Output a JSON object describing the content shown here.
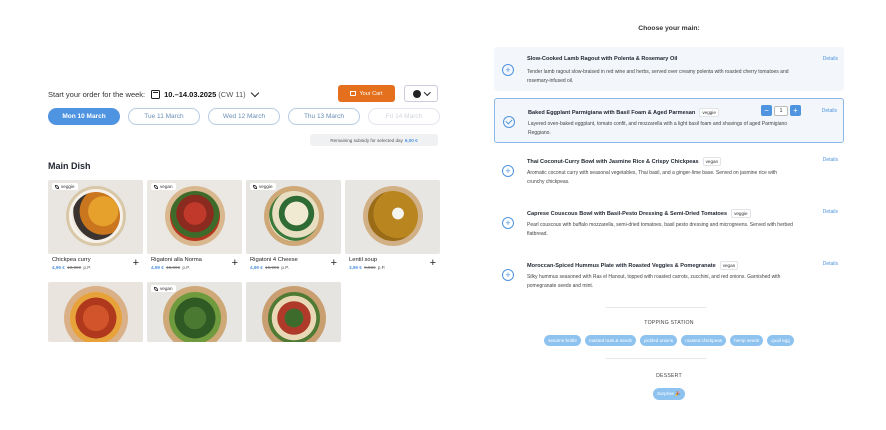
{
  "order": {
    "week_label": "Start your order for the week:",
    "week_value": "10.–14.03.2025",
    "week_cw": "(CW 11)",
    "cart_label": "Your Cart"
  },
  "days": [
    "Mon 10 March",
    "Tue 11 March",
    "Wed 12 March",
    "Thu 13 March",
    "Fri 14 March"
  ],
  "subsidy": {
    "label": "Remaining subsidy for selected day",
    "amount": "6,00 €"
  },
  "main_dish": {
    "title": "Main Dish",
    "dishes": [
      {
        "name": "Chickpea curry",
        "price": "4,99 €",
        "old_price": "10,99€",
        "unit": "p.P.",
        "tag": "veggie"
      },
      {
        "name": "Rigatoni alla Norma",
        "price": "4,99 €",
        "old_price": "10,99€",
        "unit": "p.P.",
        "tag": "vegan"
      },
      {
        "name": "Rigatoni 4 Cheese",
        "price": "4,99 €",
        "old_price": "10,99€",
        "unit": "p.P.",
        "tag": "veggie"
      },
      {
        "name": "Lentil soup",
        "price": "3,99 €",
        "old_price": "9,99€",
        "unit": "p.P.",
        "tag": ""
      },
      {
        "name": "",
        "price": "",
        "old_price": "",
        "unit": "",
        "tag": ""
      },
      {
        "name": "",
        "price": "",
        "old_price": "",
        "unit": "",
        "tag": "vegan"
      },
      {
        "name": "",
        "price": "",
        "old_price": "",
        "unit": "",
        "tag": ""
      }
    ]
  },
  "choose": {
    "title": "Choose your main:",
    "details_label": "Details",
    "options": [
      {
        "title": "Slow-Cooked Lamb Ragout with Polenta & Rosemary Oil",
        "tag": "",
        "desc": "Tender lamb ragout slow-braised in red wine and herbs, served over creamy polenta with roasted cherry tomatoes and rosemary-infused oil.",
        "selected": false
      },
      {
        "title": "Baked Eggplant Parmigiana with Basil Foam & Aged Parmesan",
        "tag": "veggie",
        "desc": "Layered oven-baked eggplant, tomato confit, and mozzarella with a light basil foam and shavings of aged Parmigiano Reggiano.",
        "selected": true,
        "qty": "1"
      },
      {
        "title": "Thai Coconut-Curry Bowl with Jasmine Rice & Crispy Chickpeas",
        "tag": "vegan",
        "desc": "Aromatic coconut curry with seasonal vegetables, Thai basil, and a ginger-lime base. Served on jasmine rice with crunchy chickpeas.",
        "selected": false
      },
      {
        "title": "Caprese Couscous Bowl with Basil-Pesto Dressing & Semi-Dried Tomatoes",
        "tag": "veggie",
        "desc": "Pearl couscous with buffalo mozzarella, semi-dried tomatoes, basil pesto dressing and microgreens. Served with herbed flatbread.",
        "selected": false
      },
      {
        "title": "Moroccan-Spiced Hummus Plate with Roasted Veggies & Pomegranate",
        "tag": "vegan",
        "desc": "Silky hummus seasoned with Ras el Hanout, topped with roasted carrots, zucchini, and red onions. Garnished with pomegranate seeds and mint.",
        "selected": false
      }
    ]
  },
  "topping": {
    "title": "TOPPING STATION",
    "chips": [
      "sesame brittle",
      "roasted nuts & seeds",
      "pickled onions",
      "roasted chickpeas",
      "hemp seeds",
      "quail egg"
    ]
  },
  "dessert": {
    "title": "DESSERT",
    "chips": [
      "Surprise 🎉"
    ]
  },
  "colors": {
    "accent": "#4f94e0",
    "cart": "#e4701e",
    "chip": "#8fc3ef"
  }
}
